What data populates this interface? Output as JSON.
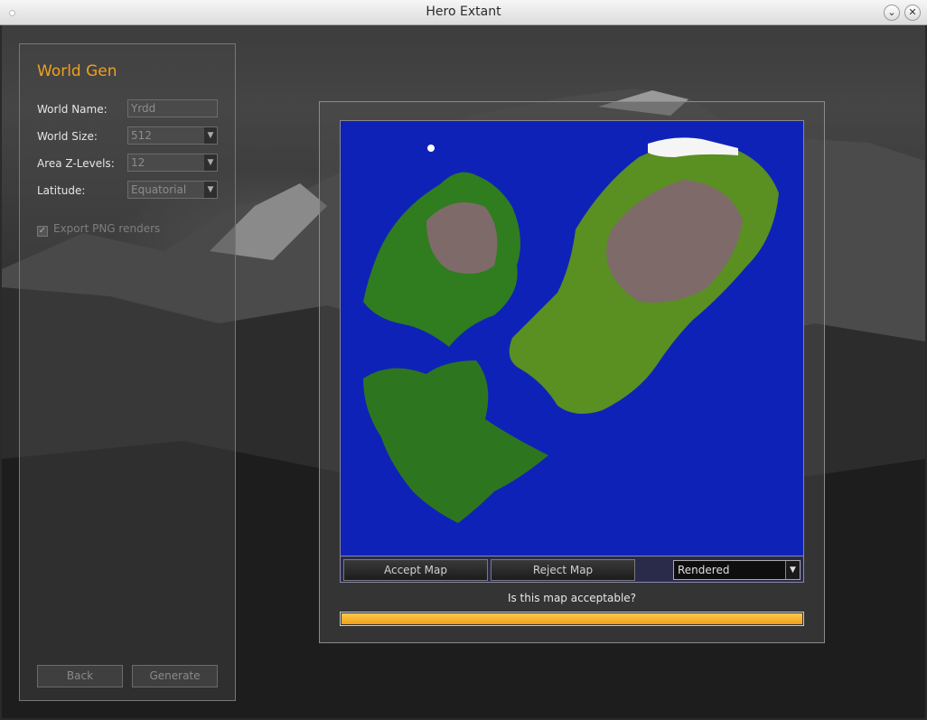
{
  "window": {
    "title": "Hero Extant"
  },
  "world_gen": {
    "title": "World Gen",
    "fields": {
      "world_name_label": "World Name:",
      "world_name_value": "Yrdd",
      "world_size_label": "World Size:",
      "world_size_value": "512",
      "area_z_levels_label": "Area Z-Levels:",
      "area_z_levels_value": "12",
      "latitude_label": "Latitude:",
      "latitude_value": "Equatorial"
    },
    "export_png_label": "Export PNG renders",
    "export_png_checked": true,
    "back_label": "Back",
    "generate_label": "Generate"
  },
  "map_panel": {
    "accept_label": "Accept Map",
    "reject_label": "Reject Map",
    "render_mode": "Rendered",
    "question": "Is this map acceptable?",
    "progress": 1.0
  },
  "colors": {
    "accent": "#f0a020",
    "ocean": "#0f22b8",
    "progress": "#f5b030"
  }
}
